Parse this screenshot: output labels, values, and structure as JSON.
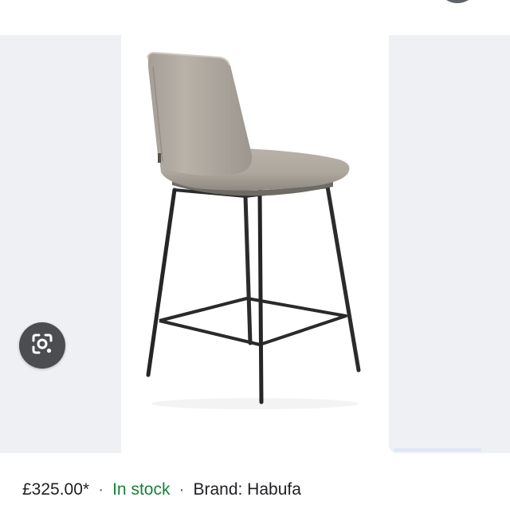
{
  "product": {
    "price": "£325.00*",
    "separator": "·",
    "availability": "In stock",
    "brand": "Brand: Habufa"
  },
  "colors": {
    "stock_green": "#188038",
    "text_dark": "#202124",
    "thumb_bg": "#eef0f3",
    "lens_button_bg": "#4b4d50"
  },
  "icons": {
    "lens": "google-lens-icon"
  }
}
